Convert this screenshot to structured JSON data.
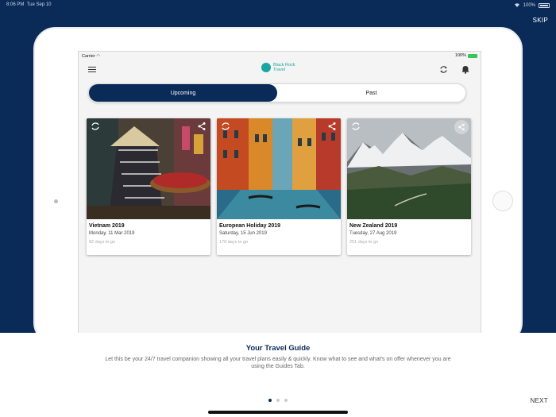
{
  "os_status": {
    "time": "8:06 PM",
    "date": "Tue Sep 10",
    "battery": "100%"
  },
  "skip_label": "SKIP",
  "device_status": {
    "carrier": "Carrier",
    "battery": "100%"
  },
  "nav": {
    "logo_text": "Black Rock Travel"
  },
  "segments": [
    {
      "label": "Upcoming",
      "active": true
    },
    {
      "label": "Past",
      "active": false
    }
  ],
  "trips": [
    {
      "title": "Vietnam 2019",
      "date": "Monday, 11 Mar 2019",
      "days": "82 days to go"
    },
    {
      "title": "European Holiday 2019",
      "date": "Saturday, 15 Jun 2019",
      "days": "178 days to go"
    },
    {
      "title": "New Zealand 2019",
      "date": "Tuesday, 27 Aug 2019",
      "days": "251 days to go"
    }
  ],
  "onboarding": {
    "title": "Your Travel Guide",
    "body": "Let this be your 24/7 travel companion showing all your travel plans easily & quickly. Know what to see and what's on offer whenever you are using the Guides Tab.",
    "page_count": 3,
    "current_page": 1,
    "next_label": "NEXT"
  },
  "colors": {
    "brand_navy": "#0a2a57",
    "brand_teal": "#1aa6a0"
  }
}
